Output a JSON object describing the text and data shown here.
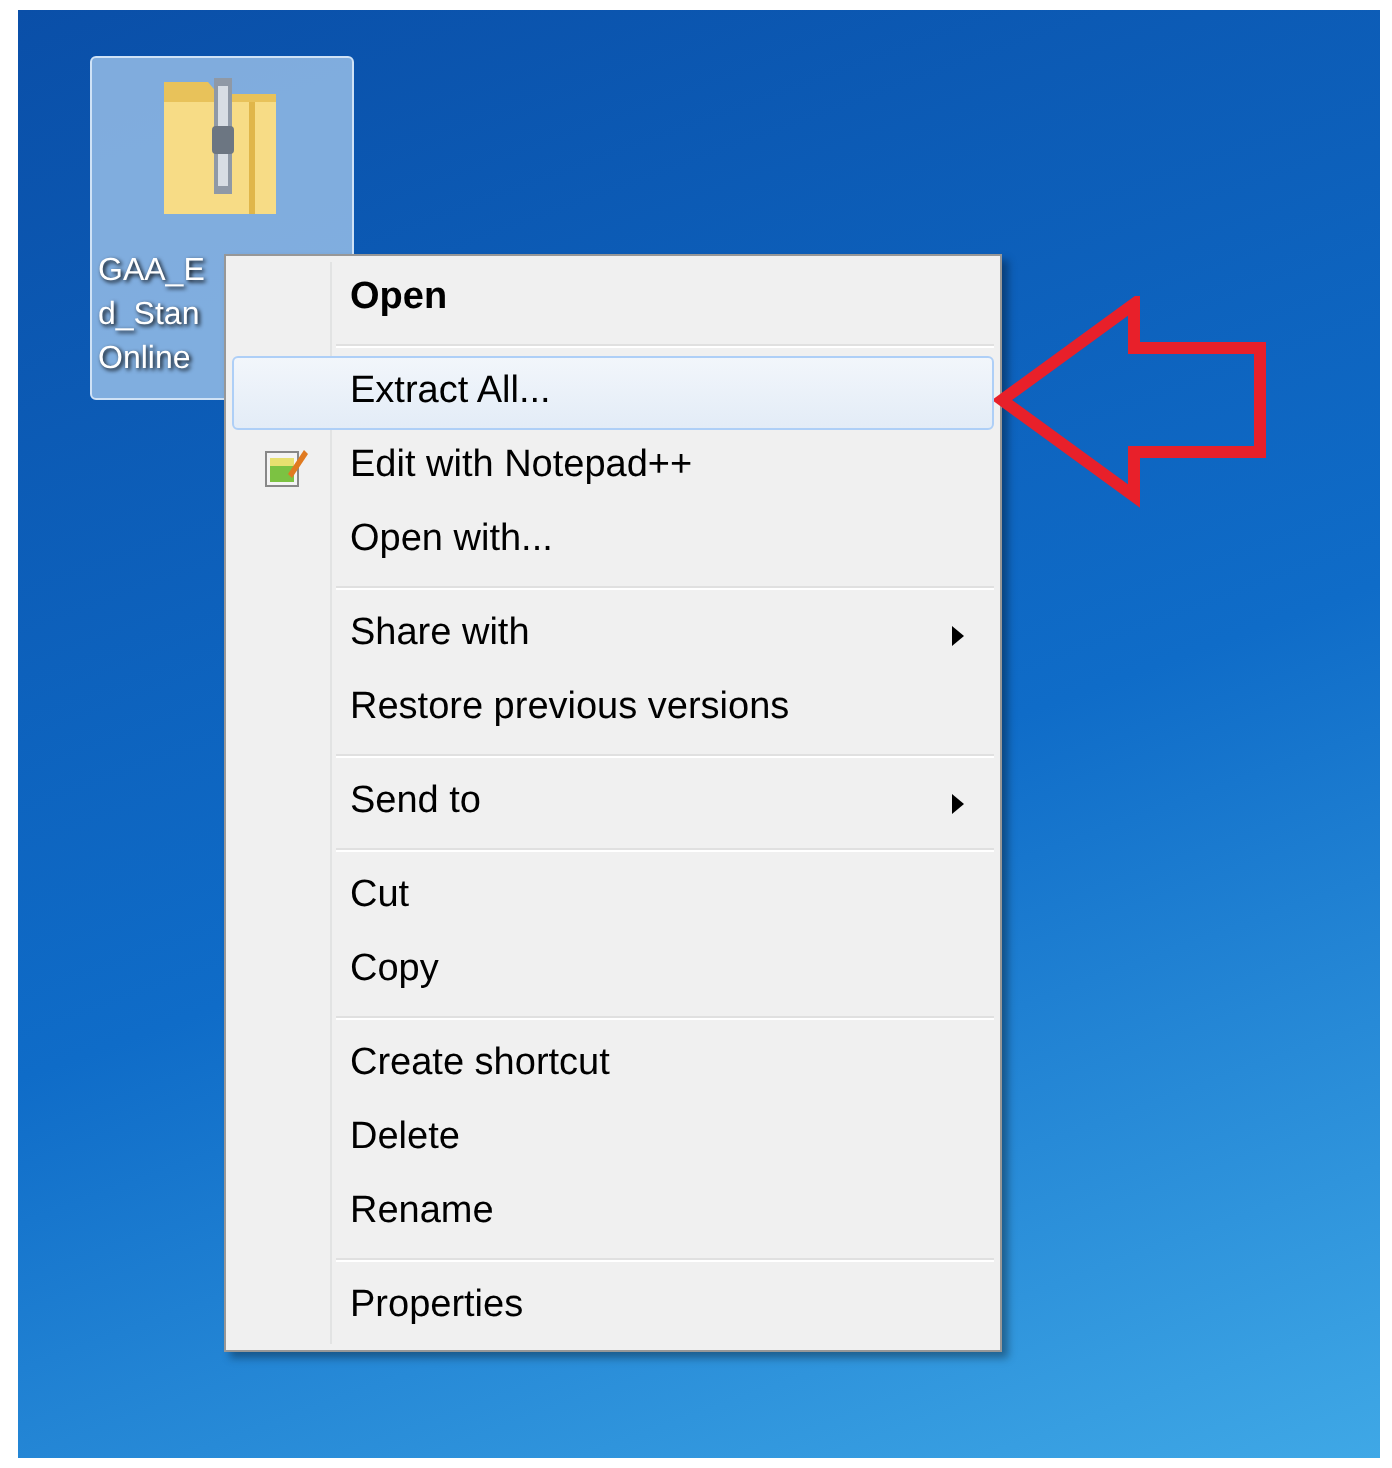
{
  "desktop_icon": {
    "label_lines": [
      "GAA_E",
      "d_Stan",
      "Online"
    ],
    "selected": true
  },
  "context_menu": {
    "groups": [
      [
        {
          "label": "Open",
          "bold": true,
          "selected": false,
          "submenu": false,
          "has_icon": false
        }
      ],
      [
        {
          "label": "Extract All...",
          "bold": false,
          "selected": true,
          "submenu": false,
          "has_icon": false
        },
        {
          "label": "Edit with Notepad++",
          "bold": false,
          "selected": false,
          "submenu": false,
          "has_icon": true
        },
        {
          "label": "Open with...",
          "bold": false,
          "selected": false,
          "submenu": false,
          "has_icon": false
        }
      ],
      [
        {
          "label": "Share with",
          "bold": false,
          "selected": false,
          "submenu": true,
          "has_icon": false
        },
        {
          "label": "Restore previous versions",
          "bold": false,
          "selected": false,
          "submenu": false,
          "has_icon": false
        }
      ],
      [
        {
          "label": "Send to",
          "bold": false,
          "selected": false,
          "submenu": true,
          "has_icon": false
        }
      ],
      [
        {
          "label": "Cut",
          "bold": false,
          "selected": false,
          "submenu": false,
          "has_icon": false
        },
        {
          "label": "Copy",
          "bold": false,
          "selected": false,
          "submenu": false,
          "has_icon": false
        }
      ],
      [
        {
          "label": "Create shortcut",
          "bold": false,
          "selected": false,
          "submenu": false,
          "has_icon": false
        },
        {
          "label": "Delete",
          "bold": false,
          "selected": false,
          "submenu": false,
          "has_icon": false
        },
        {
          "label": "Rename",
          "bold": false,
          "selected": false,
          "submenu": false,
          "has_icon": false
        }
      ],
      [
        {
          "label": "Properties",
          "bold": false,
          "selected": false,
          "submenu": false,
          "has_icon": false
        }
      ]
    ]
  }
}
